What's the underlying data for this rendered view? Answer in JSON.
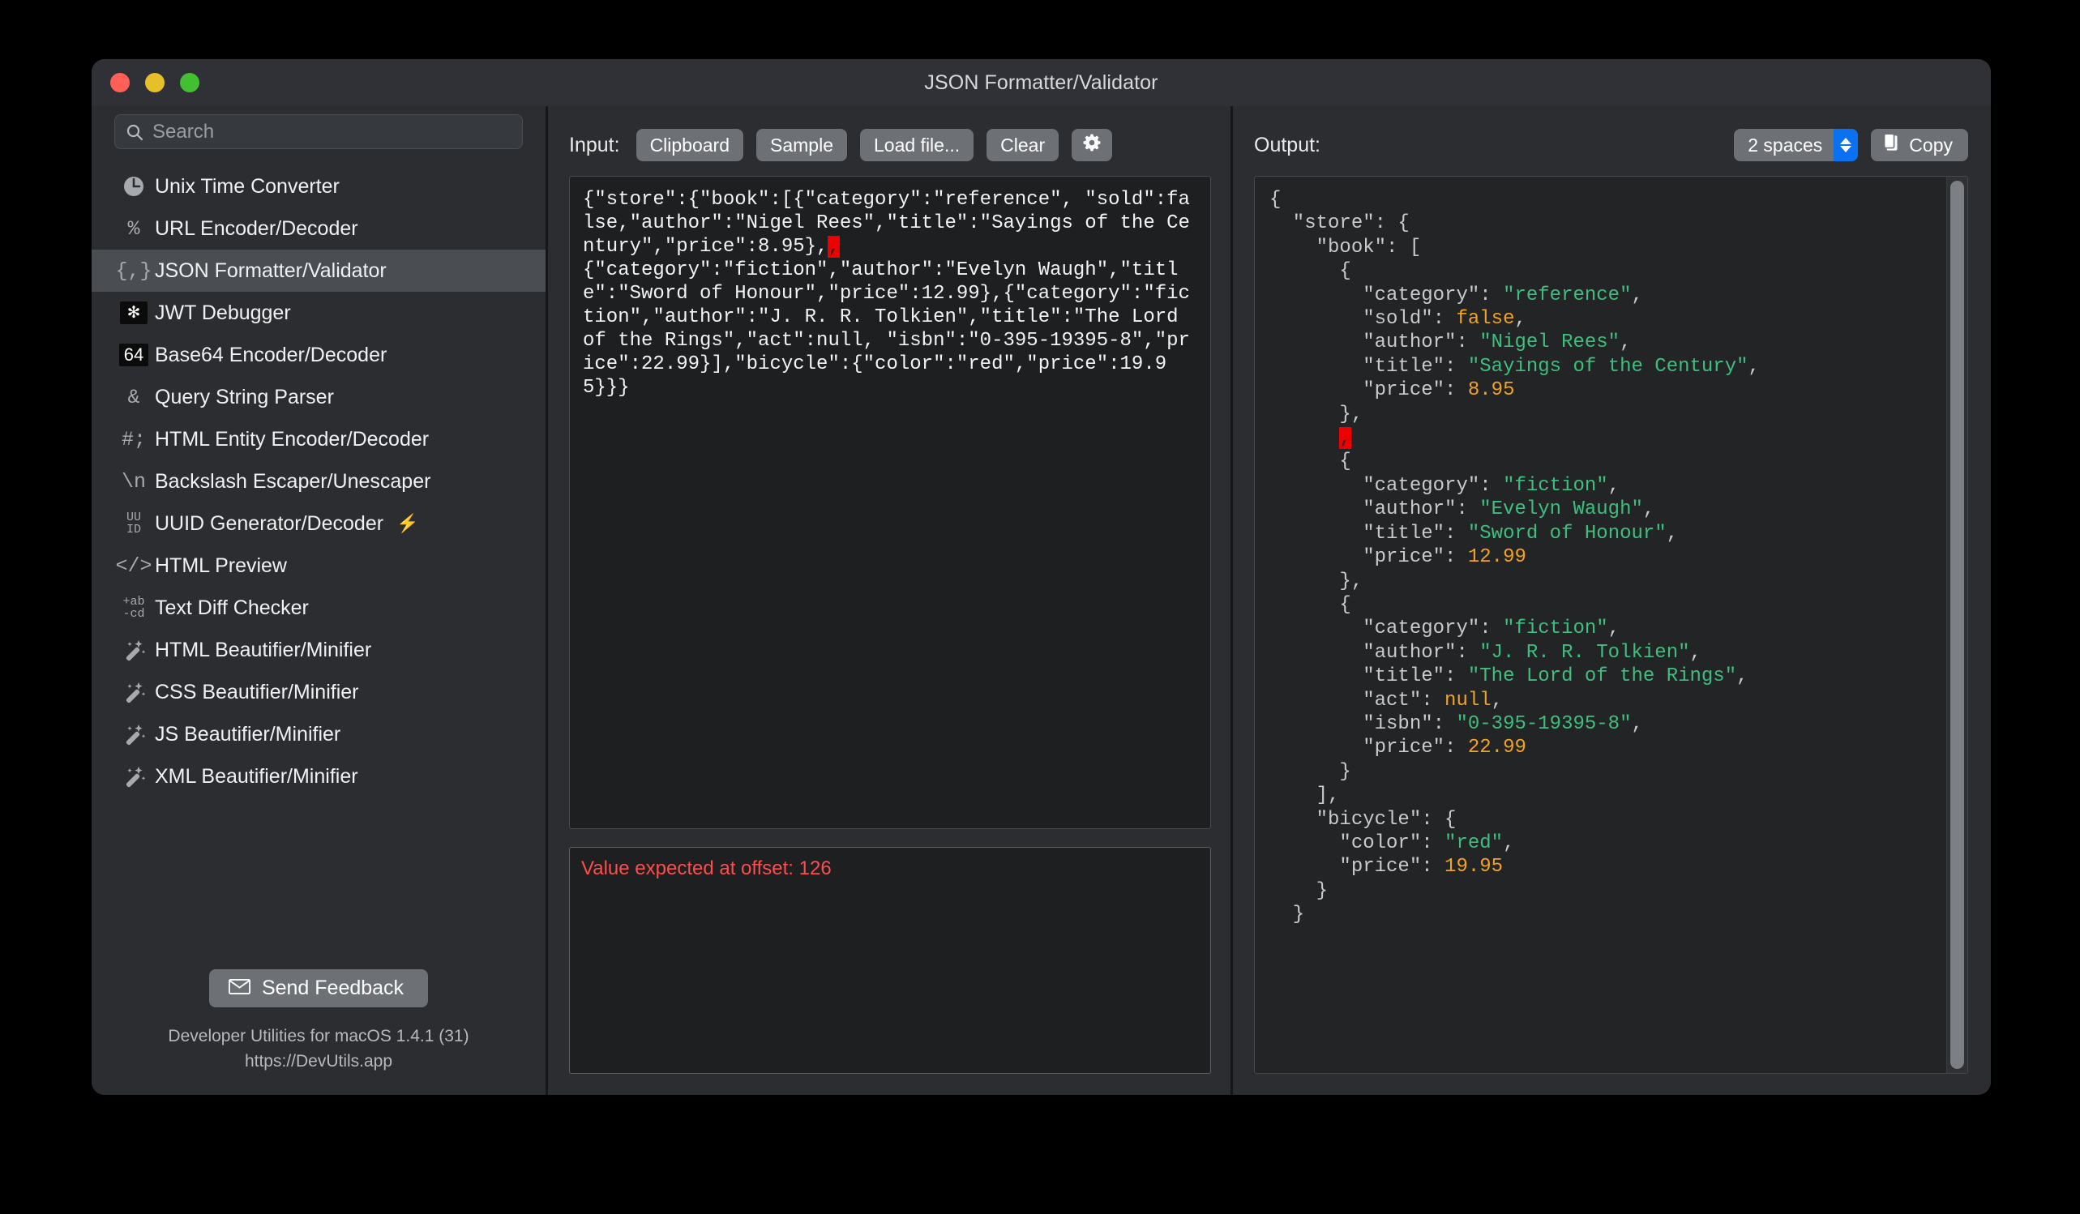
{
  "window": {
    "title": "JSON Formatter/Validator",
    "traffic_lights": [
      "close",
      "minimize",
      "zoom"
    ]
  },
  "sidebar": {
    "search": {
      "value": "",
      "placeholder": "Search"
    },
    "items": [
      {
        "label": "Unix Time Converter",
        "icon": "clock-icon",
        "glyph": "◔",
        "selected": false,
        "bolt": false
      },
      {
        "label": "URL Encoder/Decoder",
        "icon": "percent-icon",
        "glyph": "%",
        "selected": false,
        "bolt": false
      },
      {
        "label": "JSON Formatter/Validator",
        "icon": "json-braces-icon",
        "glyph": "{,}",
        "selected": true,
        "bolt": false
      },
      {
        "label": "JWT Debugger",
        "icon": "jwt-logo-icon",
        "glyph": "✻",
        "selected": false,
        "bolt": false
      },
      {
        "label": "Base64 Encoder/Decoder",
        "icon": "base64-icon",
        "glyph": "64",
        "selected": false,
        "bolt": false
      },
      {
        "label": "Query String Parser",
        "icon": "ampersand-icon",
        "glyph": "&",
        "selected": false,
        "bolt": false
      },
      {
        "label": "HTML Entity Encoder/Decoder",
        "icon": "hash-semicolon-icon",
        "glyph": "#;",
        "selected": false,
        "bolt": false
      },
      {
        "label": "Backslash Escaper/Unescaper",
        "icon": "backslash-n-icon",
        "glyph": "\\n",
        "selected": false,
        "bolt": false
      },
      {
        "label": "UUID Generator/Decoder",
        "icon": "uuid-icon",
        "glyph": "UU|ID",
        "selected": false,
        "bolt": true
      },
      {
        "label": "HTML Preview",
        "icon": "code-tags-icon",
        "glyph": "</>",
        "selected": false,
        "bolt": false
      },
      {
        "label": "Text Diff Checker",
        "icon": "text-diff-icon",
        "glyph": "+ab|-cd",
        "selected": false,
        "bolt": false
      },
      {
        "label": "HTML Beautifier/Minifier",
        "icon": "magic-wand-icon",
        "glyph": "🪄",
        "selected": false,
        "bolt": false
      },
      {
        "label": "CSS Beautifier/Minifier",
        "icon": "magic-wand-icon",
        "glyph": "🪄",
        "selected": false,
        "bolt": false
      },
      {
        "label": "JS Beautifier/Minifier",
        "icon": "magic-wand-icon",
        "glyph": "🪄",
        "selected": false,
        "bolt": false
      },
      {
        "label": "XML Beautifier/Minifier",
        "icon": "magic-wand-icon",
        "glyph": "🪄",
        "selected": false,
        "bolt": false
      }
    ],
    "footer": {
      "feedback_label": "Send Feedback",
      "feedback_icon": "envelope-icon",
      "version_line1": "Developer Utilities for macOS 1.4.1 (31)",
      "version_line2": "https://DevUtils.app"
    }
  },
  "input_pane": {
    "label": "Input:",
    "buttons": [
      {
        "label": "Clipboard",
        "name": "clipboard-button"
      },
      {
        "label": "Sample",
        "name": "sample-button"
      },
      {
        "label": "Load file...",
        "name": "load-file-button"
      },
      {
        "label": "Clear",
        "name": "clear-button"
      }
    ],
    "settings_icon": "gear-icon",
    "text_before_error": "{\"store\":{\"book\":[{\"category\":\"reference\", \"sold\":false,\"author\":\"Nigel Rees\",\"title\":\"Sayings of the Century\",\"price\":8.95},",
    "error_char": ",",
    "text_after_error": "\n{\"category\":\"fiction\",\"author\":\"Evelyn Waugh\",\"title\":\"Sword of Honour\",\"price\":12.99},{\"category\":\"fiction\",\"author\":\"J. R. R. Tolkien\",\"title\":\"The Lord of the Rings\",\"act\":null, \"isbn\":\"0-395-19395-8\",\"price\":22.99}],\"bicycle\":{\"color\":\"red\",\"price\":19.95}}}",
    "error_message": "Value expected at offset: 126"
  },
  "output_pane": {
    "label": "Output:",
    "indent_value": "2 spaces",
    "copy_label": "Copy",
    "copy_icon": "clipboard-icon",
    "stepper_icon": "up-down-chevron-icon",
    "scrollbar": "vertical-scrollbar",
    "lines": [
      [
        {
          "t": "{",
          "c": "punct"
        }
      ],
      [
        {
          "t": "  \"store\"",
          "c": "key"
        },
        {
          "t": ": {",
          "c": "punct"
        }
      ],
      [
        {
          "t": "    \"book\"",
          "c": "key"
        },
        {
          "t": ": [",
          "c": "punct"
        }
      ],
      [
        {
          "t": "      {",
          "c": "punct"
        }
      ],
      [
        {
          "t": "        \"category\"",
          "c": "key"
        },
        {
          "t": ": ",
          "c": "punct"
        },
        {
          "t": "\"reference\"",
          "c": "str"
        },
        {
          "t": ",",
          "c": "punct"
        }
      ],
      [
        {
          "t": "        \"sold\"",
          "c": "key"
        },
        {
          "t": ": ",
          "c": "punct"
        },
        {
          "t": "false",
          "c": "lit"
        },
        {
          "t": ",",
          "c": "punct"
        }
      ],
      [
        {
          "t": "        \"author\"",
          "c": "key"
        },
        {
          "t": ": ",
          "c": "punct"
        },
        {
          "t": "\"Nigel Rees\"",
          "c": "str"
        },
        {
          "t": ",",
          "c": "punct"
        }
      ],
      [
        {
          "t": "        \"title\"",
          "c": "key"
        },
        {
          "t": ": ",
          "c": "punct"
        },
        {
          "t": "\"Sayings of the Century\"",
          "c": "str"
        },
        {
          "t": ",",
          "c": "punct"
        }
      ],
      [
        {
          "t": "        \"price\"",
          "c": "key"
        },
        {
          "t": ": ",
          "c": "punct"
        },
        {
          "t": "8.95",
          "c": "num"
        }
      ],
      [
        {
          "t": "      },",
          "c": "punct"
        }
      ],
      [
        {
          "t": "      ",
          "c": "punct"
        },
        {
          "t": ",",
          "c": "err"
        }
      ],
      [
        {
          "t": "      {",
          "c": "punct"
        }
      ],
      [
        {
          "t": "        \"category\"",
          "c": "key"
        },
        {
          "t": ": ",
          "c": "punct"
        },
        {
          "t": "\"fiction\"",
          "c": "str"
        },
        {
          "t": ",",
          "c": "punct"
        }
      ],
      [
        {
          "t": "        \"author\"",
          "c": "key"
        },
        {
          "t": ": ",
          "c": "punct"
        },
        {
          "t": "\"Evelyn Waugh\"",
          "c": "str"
        },
        {
          "t": ",",
          "c": "punct"
        }
      ],
      [
        {
          "t": "        \"title\"",
          "c": "key"
        },
        {
          "t": ": ",
          "c": "punct"
        },
        {
          "t": "\"Sword of Honour\"",
          "c": "str"
        },
        {
          "t": ",",
          "c": "punct"
        }
      ],
      [
        {
          "t": "        \"price\"",
          "c": "key"
        },
        {
          "t": ": ",
          "c": "punct"
        },
        {
          "t": "12.99",
          "c": "num"
        }
      ],
      [
        {
          "t": "      },",
          "c": "punct"
        }
      ],
      [
        {
          "t": "      {",
          "c": "punct"
        }
      ],
      [
        {
          "t": "        \"category\"",
          "c": "key"
        },
        {
          "t": ": ",
          "c": "punct"
        },
        {
          "t": "\"fiction\"",
          "c": "str"
        },
        {
          "t": ",",
          "c": "punct"
        }
      ],
      [
        {
          "t": "        \"author\"",
          "c": "key"
        },
        {
          "t": ": ",
          "c": "punct"
        },
        {
          "t": "\"J. R. R. Tolkien\"",
          "c": "str"
        },
        {
          "t": ",",
          "c": "punct"
        }
      ],
      [
        {
          "t": "        \"title\"",
          "c": "key"
        },
        {
          "t": ": ",
          "c": "punct"
        },
        {
          "t": "\"The Lord of the Rings\"",
          "c": "str"
        },
        {
          "t": ",",
          "c": "punct"
        }
      ],
      [
        {
          "t": "        \"act\"",
          "c": "key"
        },
        {
          "t": ": ",
          "c": "punct"
        },
        {
          "t": "null",
          "c": "lit"
        },
        {
          "t": ",",
          "c": "punct"
        }
      ],
      [
        {
          "t": "        \"isbn\"",
          "c": "key"
        },
        {
          "t": ": ",
          "c": "punct"
        },
        {
          "t": "\"0-395-19395-8\"",
          "c": "str"
        },
        {
          "t": ",",
          "c": "punct"
        }
      ],
      [
        {
          "t": "        \"price\"",
          "c": "key"
        },
        {
          "t": ": ",
          "c": "punct"
        },
        {
          "t": "22.99",
          "c": "num"
        }
      ],
      [
        {
          "t": "      }",
          "c": "punct"
        }
      ],
      [
        {
          "t": "    ],",
          "c": "punct"
        }
      ],
      [
        {
          "t": "    \"bicycle\"",
          "c": "key"
        },
        {
          "t": ": {",
          "c": "punct"
        }
      ],
      [
        {
          "t": "      \"color\"",
          "c": "key"
        },
        {
          "t": ": ",
          "c": "punct"
        },
        {
          "t": "\"red\"",
          "c": "str"
        },
        {
          "t": ",",
          "c": "punct"
        }
      ],
      [
        {
          "t": "      \"price\"",
          "c": "key"
        },
        {
          "t": ": ",
          "c": "punct"
        },
        {
          "t": "19.95",
          "c": "num"
        }
      ],
      [
        {
          "t": "    }",
          "c": "punct"
        }
      ],
      [
        {
          "t": "  }",
          "c": "punct"
        }
      ]
    ]
  },
  "colors": {
    "window_bg": "#2b2d30",
    "editor_bg": "#1e1f21",
    "output_bg": "#232426",
    "accent_blue": "#0a72f0",
    "error_red": "#ee0000",
    "error_text": "#ff4d4d",
    "string_green": "#3fbf7f",
    "number_orange": "#f0a323",
    "selected_row": "#4a4d52"
  }
}
